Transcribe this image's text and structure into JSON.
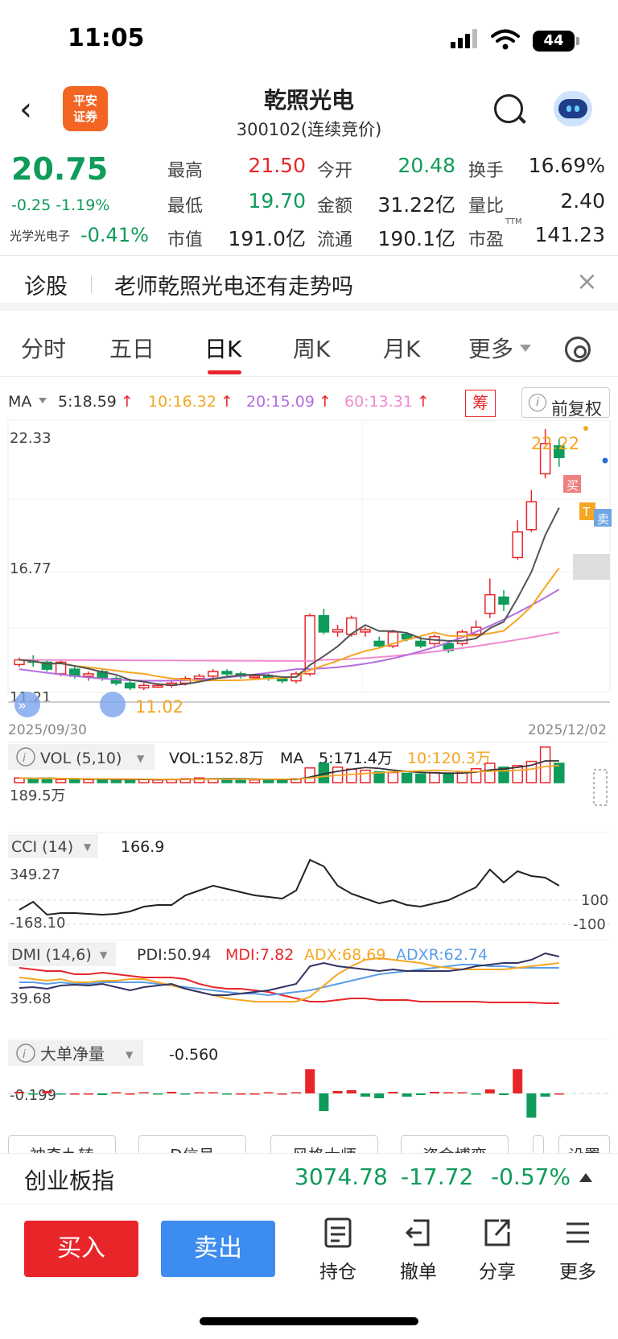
{
  "status_bar": {
    "time": "11:05",
    "battery": "44"
  },
  "header": {
    "logo_text_1": "平安",
    "logo_text_2": "证券",
    "title": "乾照光电",
    "subtitle": "300102(连续竞价)"
  },
  "quote": {
    "price": "20.75",
    "change": "-0.25 -1.19%",
    "sector_name": "光学光电子",
    "sector_change": "-0.41%",
    "rows": [
      [
        {
          "label": "最高",
          "value": "21.50"
        },
        {
          "label": "今开",
          "value": "20.48"
        },
        {
          "label": "换手",
          "value": "16.69%"
        }
      ],
      [
        {
          "label": "最低",
          "value": "19.70"
        },
        {
          "label": "金额",
          "value": "31.22亿"
        },
        {
          "label": "量比",
          "value": "2.40"
        }
      ],
      [
        {
          "label": "市值",
          "value": "191.0亿"
        },
        {
          "label": "流通",
          "value": "190.1亿"
        },
        {
          "label": "市盈",
          "value": "141.23"
        }
      ]
    ],
    "ttm": "TTM"
  },
  "diagnosis": {
    "label": "诊股",
    "text": "老师乾照光电还有走势吗",
    "close": "×"
  },
  "tabs": [
    "分时",
    "五日",
    "日K",
    "周K",
    "月K",
    "更多"
  ],
  "ma_legend": {
    "label": "MA",
    "ma5": "5:18.59",
    "ma10": "10:16.32",
    "ma20": "20:15.09",
    "ma60": "60:13.31",
    "chou": "筹",
    "fuquan": "前复权"
  },
  "kline": {
    "y_labels": [
      "22.33",
      "16.77",
      "11.21"
    ],
    "high_marker": "22.22",
    "low_marker": "11.02",
    "date_start": "2025/09/30",
    "date_end": "2025/12/02",
    "tag_buy": "买",
    "tag_sell": "卖",
    "tag_t": "T"
  },
  "vol": {
    "label": "VOL (5,10)",
    "vol": "VOL:152.8万",
    "ma": "MA",
    "ma5": "5:171.4万",
    "ma10": "10:120.3万",
    "y_label": "189.5万"
  },
  "cci": {
    "label": "CCI (14)",
    "value": "166.9",
    "y_top": "349.27",
    "y_bottom": "-168.10",
    "ref_top": "100",
    "ref_bottom": "-100"
  },
  "dmi": {
    "label": "DMI (14,6)",
    "pdi": "PDI:50.94",
    "mdi": "MDI:7.82",
    "adx": "ADX:68.69",
    "adxr": "ADXR:62.74",
    "y_label": "39.68"
  },
  "big_order": {
    "label": "大单净量",
    "value": "-0.560",
    "y_label": "-0.199"
  },
  "indicator_buttons": [
    "神奇九转",
    "D信号",
    "风格大师",
    "资金博弈",
    "设置"
  ],
  "index_bar": {
    "name": "创业板指",
    "value": "3074.78",
    "change": "-17.72",
    "pct": "-0.57%"
  },
  "bottom_bar": {
    "buy": "买入",
    "sell": "卖出",
    "items": [
      "持仓",
      "撤单",
      "分享",
      "更多"
    ]
  },
  "colors": {
    "up": "#e8262a",
    "down": "#0f9b5a",
    "ma5": "#333333",
    "ma10": "#f5a623",
    "ma20": "#b46de0",
    "ma60": "#f08ad0",
    "accent_blue": "#3d8cf0"
  }
}
